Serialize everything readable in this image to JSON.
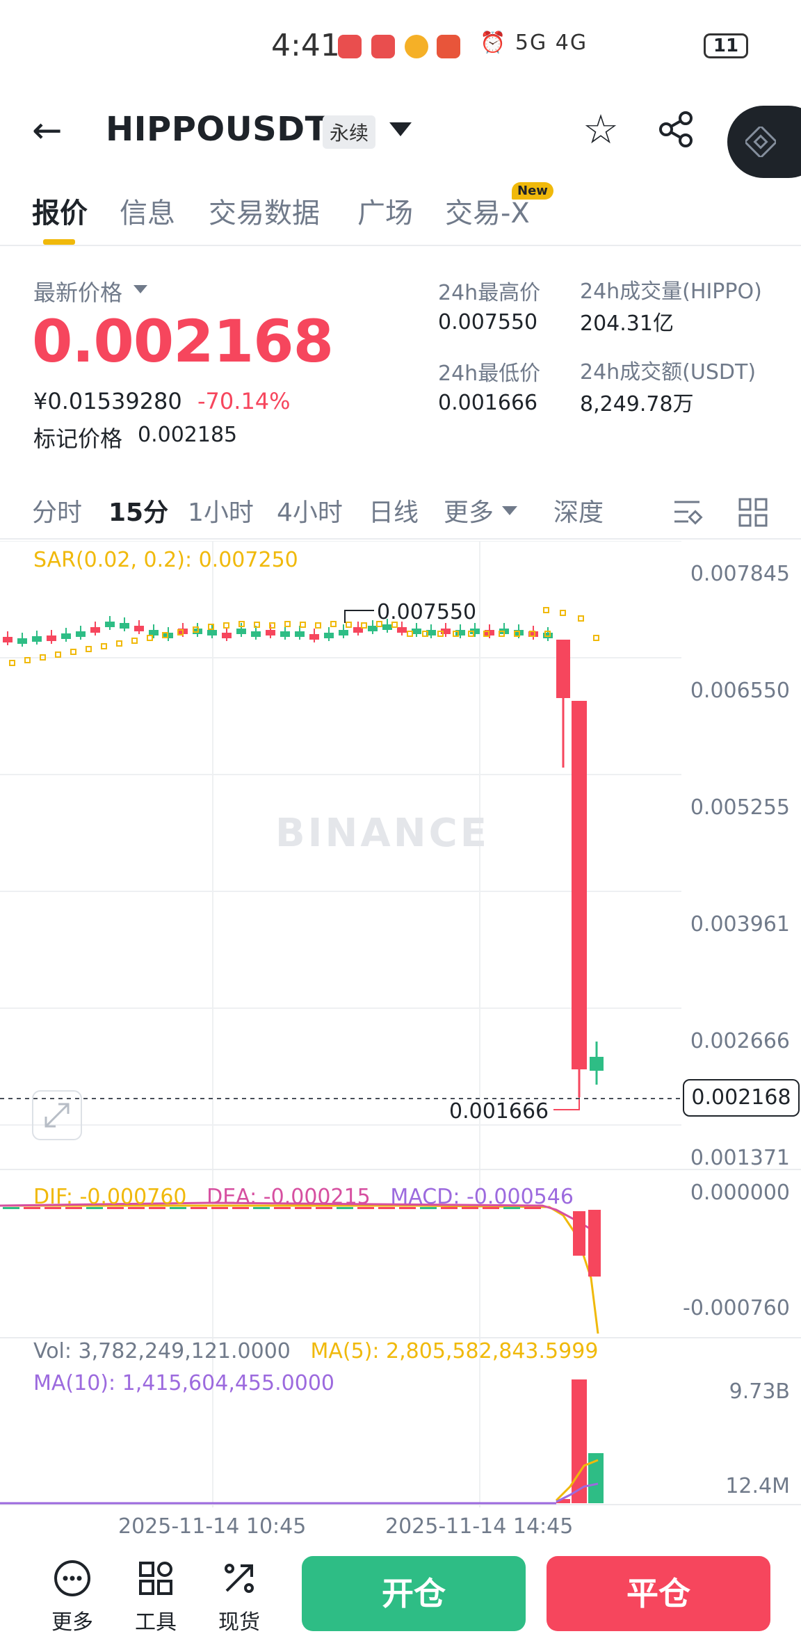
{
  "status_bar": {
    "time": "4:41",
    "network_right": "⏰ 5G 4G",
    "battery": "11"
  },
  "header": {
    "symbol": "HIPPOUSDT",
    "contract_type": "永续"
  },
  "tabs": [
    {
      "label": "报价"
    },
    {
      "label": "信息"
    },
    {
      "label": "交易数据"
    },
    {
      "label": "广场"
    },
    {
      "label": "交易-X"
    }
  ],
  "new_badge": "New",
  "price": {
    "last_label": "最新价格",
    "last": "0.002168",
    "cny": "¥0.01539280",
    "change": "-70.14%",
    "mark_label": "标记价格",
    "mark": "0.002185"
  },
  "stats": {
    "high_label": "24h最高价",
    "high": "0.007550",
    "low_label": "24h最低价",
    "low": "0.001666",
    "vol_label": "24h成交量(HIPPO)",
    "vol": "204.31亿",
    "amt_label": "24h成交额(USDT)",
    "amt": "8,249.78万"
  },
  "intervals": {
    "time": "分时",
    "m15": "15分",
    "h1": "1小时",
    "h4": "4小时",
    "d1": "日线",
    "more": "更多",
    "depth": "深度"
  },
  "chart": {
    "watermark": "BINANCE",
    "sar": "SAR(0.02, 0.2): 0.007250",
    "price_axis": [
      "0.007845",
      "0.006550",
      "0.005255",
      "0.003961",
      "0.002666",
      "0.001371"
    ],
    "current_price": "0.002168",
    "high_mark": "0.007550",
    "low_mark": "0.001666",
    "macd": {
      "dif": "DIF: -0.000760",
      "dea": "DEA: -0.000215",
      "macd": "MACD: -0.000546",
      "axis": [
        "0.000000",
        "-0.000760"
      ]
    },
    "volume": {
      "vol": "Vol: 3,782,249,121.0000",
      "ma5": "MA(5): 2,805,582,843.5999",
      "ma10": "MA(10): 1,415,604,455.0000",
      "axis": [
        "9.73B",
        "12.4M"
      ]
    },
    "dates": [
      "2025-11-14 10:45",
      "2025-11-14 14:45"
    ],
    "colors": {
      "up": "#2ebd85",
      "down": "#f6465d",
      "sar": "#f0b90b",
      "dea": "#d64fa0",
      "macd": "#9c6ade"
    }
  },
  "bottom": {
    "more": "更多",
    "tools": "工具",
    "spot": "现货",
    "open": "开仓",
    "close": "平仓"
  }
}
